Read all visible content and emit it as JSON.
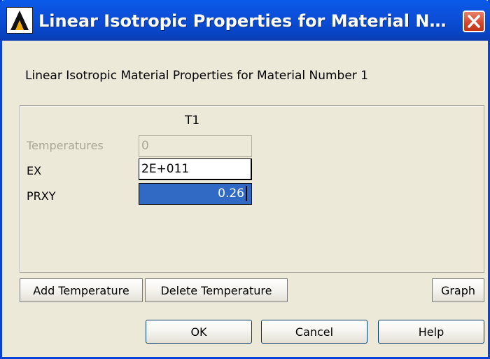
{
  "window": {
    "title": "Linear Isotropic Properties for Material Numb...",
    "logo_icon": "ansys-logo-icon",
    "close_icon": "close-icon",
    "accent_color": "#0a4fd9",
    "close_color": "#d4452a"
  },
  "heading": "Linear Isotropic Material Properties for Material Number 1",
  "table": {
    "column_header": "T1",
    "rows": [
      {
        "label": "Temperatures",
        "value": "0",
        "state": "disabled"
      },
      {
        "label": "EX",
        "value": "2E+011",
        "state": "normal"
      },
      {
        "label": "PRXY",
        "value": "0.26",
        "state": "selected"
      }
    ]
  },
  "buttons": {
    "add_temperature": "Add Temperature",
    "delete_temperature": "Delete Temperature",
    "graph": "Graph",
    "ok": "OK",
    "cancel": "Cancel",
    "help": "Help"
  }
}
